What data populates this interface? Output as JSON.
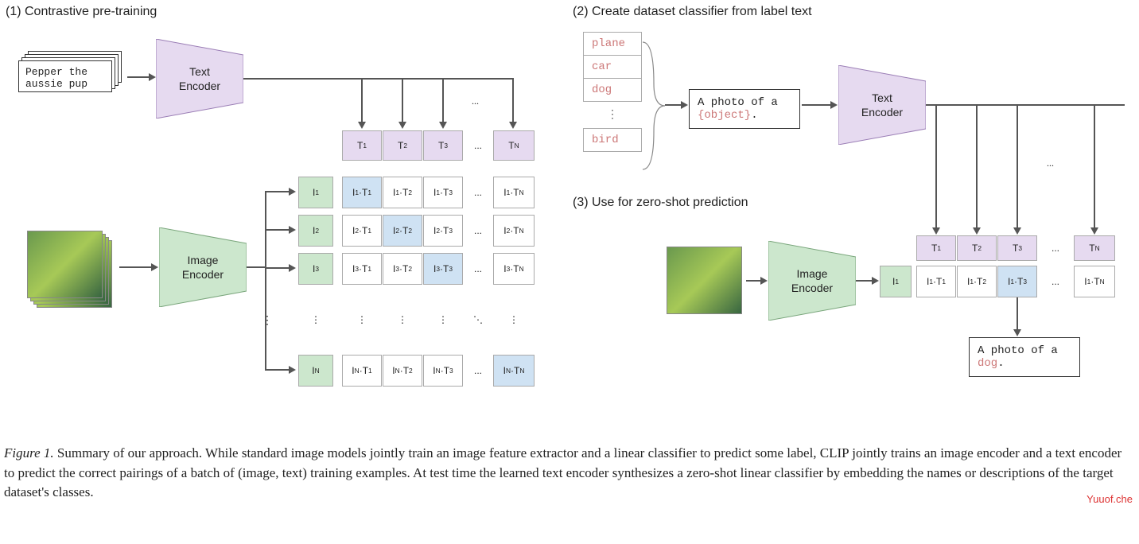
{
  "section1_title": "(1) Contrastive pre-training",
  "section2_title": "(2) Create dataset classifier from label text",
  "section3_title": "(3) Use for zero-shot prediction",
  "text_input": "Pepper the aussie pup",
  "text_encoder_label": "Text\nEncoder",
  "image_encoder_label": "Image\nEncoder",
  "t_labels": [
    "T₁",
    "T₂",
    "T₃",
    "...",
    "T_N"
  ],
  "i_labels": [
    "I₁",
    "I₂",
    "I₃",
    "⋮",
    "I_N"
  ],
  "matrix": [
    [
      "I₁·T₁",
      "I₁·T₂",
      "I₁·T₃",
      "...",
      "I₁·T_N"
    ],
    [
      "I₂·T₁",
      "I₂·T₂",
      "I₂·T₃",
      "...",
      "I₂·T_N"
    ],
    [
      "I₃·T₁",
      "I₃·T₂",
      "I₃·T₃",
      "...",
      "I₃·T_N"
    ],
    [
      "⋮",
      "⋮",
      "⋮",
      "⋱",
      "⋮"
    ],
    [
      "I_N·T₁",
      "I_N·T₂",
      "I_N·T₃",
      "...",
      "I_N·T_N"
    ]
  ],
  "class_labels": [
    "plane",
    "car",
    "dog",
    "bird"
  ],
  "class_ellipsis": "⋮",
  "prompt_text_prefix": "A photo of a ",
  "prompt_text_object": "{object}",
  "prompt_text_suffix": ".",
  "i1_label": "I₁",
  "row3": [
    "I₁·T₁",
    "I₁·T₂",
    "I₁·T₃",
    "...",
    "I₁·T_N"
  ],
  "result_prefix": "A photo of a ",
  "result_object": "dog",
  "result_suffix": ".",
  "caption_strong": "Figure 1.",
  "caption_text": " Summary of our approach. While standard image models jointly train an image feature extractor and a linear classifier to predict some label, CLIP jointly trains an image encoder and a text encoder to predict the correct pairings of a batch of (image, text) training examples. At test time the learned text encoder synthesizes a zero-shot linear classifier by embedding the names or descriptions of the target dataset's classes.",
  "watermark": "Yuuof.che"
}
